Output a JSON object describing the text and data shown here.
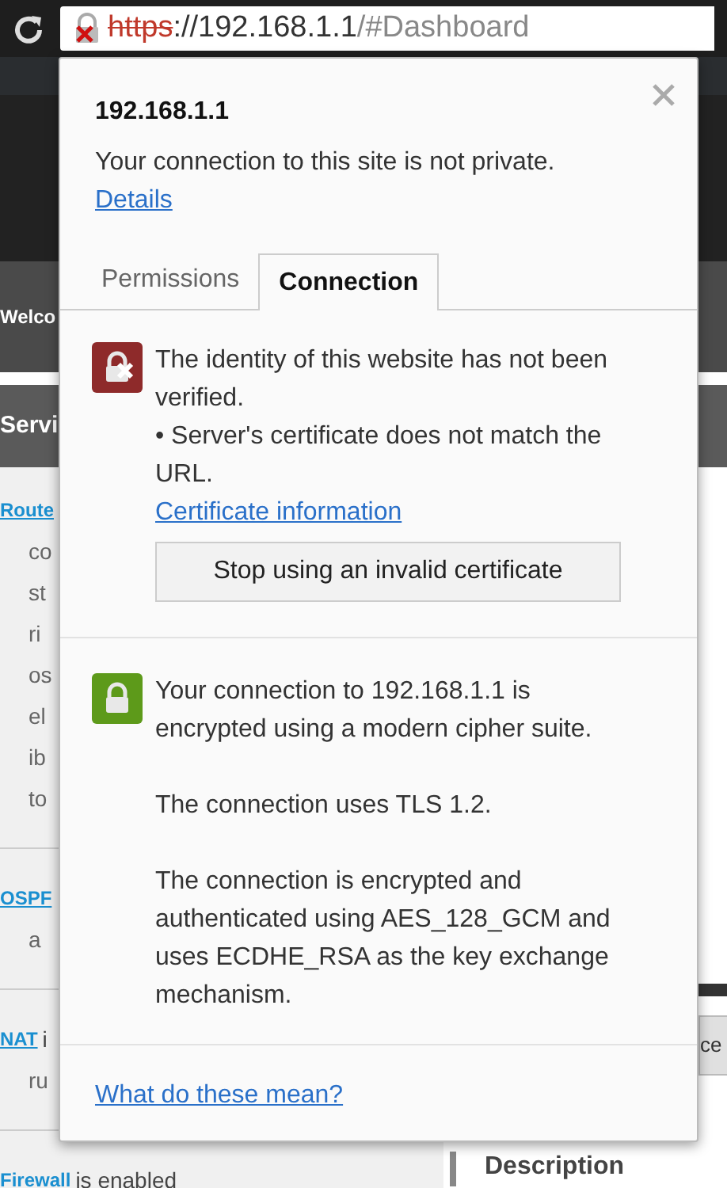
{
  "toolbar": {
    "url_scheme": "https",
    "url_host": "://192.168.1.1",
    "url_path": "/#Dashboard"
  },
  "background_page": {
    "nav_label": "Welco",
    "section_label": "Servi",
    "left_items": [
      {
        "kind": "link",
        "link": "Route"
      },
      {
        "kind": "text",
        "text": "co"
      },
      {
        "kind": "text",
        "text": "st"
      },
      {
        "kind": "text",
        "text": "ri"
      },
      {
        "kind": "text",
        "text": "os"
      },
      {
        "kind": "text",
        "text": "el"
      },
      {
        "kind": "text",
        "text": "ib"
      },
      {
        "kind": "text",
        "text": "to"
      },
      {
        "kind": "divider"
      },
      {
        "kind": "link",
        "link": "OSPF"
      },
      {
        "kind": "text",
        "text": "a"
      },
      {
        "kind": "divider"
      },
      {
        "kind": "link",
        "link": "NAT",
        "rest": "i"
      },
      {
        "kind": "text",
        "text": "ru"
      },
      {
        "kind": "divider"
      },
      {
        "kind": "link",
        "link": "Firewall",
        "rest": "is enabled"
      }
    ],
    "right_button": "ce",
    "right_heading": "Description"
  },
  "popup": {
    "title": "192.168.1.1",
    "subtitle": "Your connection to this site is not private.",
    "details_link": "Details",
    "tabs": [
      {
        "label": "Permissions",
        "selected": false
      },
      {
        "label": "Connection",
        "selected": true
      }
    ],
    "sections": [
      {
        "kind": "error",
        "paragraphs": [
          "The identity of this website has not been verified.",
          "• Server's certificate does not match the URL."
        ],
        "link": "Certificate information",
        "button": "Stop using an invalid certificate"
      },
      {
        "kind": "secure",
        "paragraphs": [
          "Your connection to 192.168.1.1 is encrypted using a modern cipher suite.",
          "The connection uses TLS 1.2.",
          "The connection is encrypted and authenticated using AES_128_GCM and uses ECDHE_RSA as the key exchange mechanism."
        ]
      }
    ],
    "footer_link": "What do these mean?"
  }
}
